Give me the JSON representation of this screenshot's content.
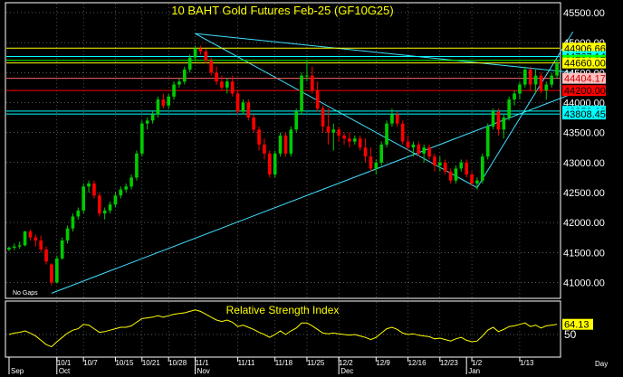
{
  "colors": {
    "background": "#000000",
    "frame": "#ffffff",
    "title": "#ffff00",
    "up_candle": "#00cc00",
    "down_candle": "#ff0000",
    "trendline": "#40e0ff",
    "rsi_line": "#ffff00",
    "grid": "#ffffff"
  },
  "chart_data": [
    {
      "type": "candlestick",
      "title": "10 BAHT Gold Futures Feb-25 (GF10G25)",
      "footnote": "No Gaps",
      "ylim": [
        40750,
        45650
      ],
      "y_ticks": [
        41000,
        41500,
        42000,
        42500,
        43000,
        43500,
        44000,
        44500,
        45000,
        45500
      ],
      "y_tick_labels": [
        "41000.00",
        "41500.00",
        "42000.00",
        "42500.00",
        "43000.00",
        "43500.00",
        "44000.00",
        "44500.00",
        "45000.00",
        "45500.00"
      ],
      "grid": "dotted",
      "bars": 104,
      "candles": [
        [
          0,
          41550,
          41600,
          41520,
          41580
        ],
        [
          1,
          41580,
          41650,
          41540,
          41600
        ],
        [
          2,
          41600,
          41680,
          41560,
          41620
        ],
        [
          3,
          41620,
          41860,
          41600,
          41850
        ],
        [
          4,
          41850,
          41880,
          41700,
          41750
        ],
        [
          5,
          41750,
          41800,
          41600,
          41700
        ],
        [
          6,
          41700,
          41780,
          41500,
          41550
        ],
        [
          7,
          41550,
          41600,
          41300,
          41350
        ],
        [
          8,
          41300,
          41320,
          40950,
          41000
        ],
        [
          9,
          41000,
          41450,
          40980,
          41400
        ],
        [
          10,
          41400,
          41750,
          41380,
          41700
        ],
        [
          11,
          41700,
          41950,
          41650,
          41900
        ],
        [
          12,
          41900,
          42150,
          41850,
          42100
        ],
        [
          13,
          42100,
          42250,
          42050,
          42200
        ],
        [
          14,
          42200,
          42650,
          42150,
          42600
        ],
        [
          15,
          42600,
          42700,
          42500,
          42650
        ],
        [
          16,
          42650,
          42700,
          42400,
          42450
        ],
        [
          17,
          42450,
          42500,
          42100,
          42150
        ],
        [
          18,
          42150,
          42250,
          42050,
          42200
        ],
        [
          19,
          42200,
          42350,
          42150,
          42300
        ],
        [
          20,
          42300,
          42500,
          42250,
          42450
        ],
        [
          21,
          42450,
          42600,
          42400,
          42550
        ],
        [
          22,
          42550,
          42650,
          42500,
          42600
        ],
        [
          23,
          42600,
          42800,
          42550,
          42750
        ],
        [
          24,
          42750,
          43200,
          42700,
          43150
        ],
        [
          25,
          43150,
          43700,
          43100,
          43650
        ],
        [
          26,
          43650,
          43750,
          43550,
          43700
        ],
        [
          27,
          43700,
          43850,
          43650,
          43800
        ],
        [
          28,
          43800,
          44100,
          43750,
          44050
        ],
        [
          29,
          44050,
          44150,
          43900,
          43950
        ],
        [
          30,
          43950,
          44150,
          43900,
          44100
        ],
        [
          31,
          44100,
          44350,
          44050,
          44300
        ],
        [
          32,
          44300,
          44400,
          44250,
          44350
        ],
        [
          33,
          44350,
          44600,
          44300,
          44550
        ],
        [
          34,
          44550,
          44800,
          44500,
          44750
        ],
        [
          35,
          44750,
          44950,
          44700,
          44900
        ],
        [
          36,
          44900,
          44950,
          44800,
          44850
        ],
        [
          37,
          44850,
          44900,
          44650,
          44700
        ],
        [
          38,
          44700,
          44750,
          44450,
          44500
        ],
        [
          39,
          44500,
          44600,
          44300,
          44350
        ],
        [
          40,
          44350,
          44450,
          44200,
          44250
        ],
        [
          41,
          44250,
          44400,
          44150,
          44350
        ],
        [
          42,
          44350,
          44450,
          44100,
          44150
        ],
        [
          43,
          44150,
          44200,
          43800,
          43850
        ],
        [
          44,
          43850,
          44050,
          43800,
          44000
        ],
        [
          45,
          44000,
          44050,
          43700,
          43750
        ],
        [
          46,
          43750,
          43800,
          43500,
          43550
        ],
        [
          47,
          43550,
          43600,
          43200,
          43300
        ],
        [
          48,
          43300,
          43400,
          43050,
          43150
        ],
        [
          49,
          43150,
          43200,
          42750,
          42800
        ],
        [
          50,
          42800,
          43200,
          42750,
          43150
        ],
        [
          51,
          43150,
          43500,
          43100,
          43450
        ],
        [
          52,
          43450,
          43500,
          43100,
          43150
        ],
        [
          53,
          43150,
          43600,
          43100,
          43550
        ],
        [
          54,
          43550,
          43900,
          43500,
          43850
        ],
        [
          55,
          43850,
          44500,
          43800,
          44450
        ],
        [
          56,
          44450,
          44700,
          44350,
          44450
        ],
        [
          57,
          44450,
          44600,
          44150,
          44200
        ],
        [
          58,
          44200,
          44350,
          43850,
          43900
        ],
        [
          59,
          43900,
          43950,
          43500,
          43600
        ],
        [
          60,
          43600,
          43900,
          43300,
          43500
        ],
        [
          61,
          43500,
          43650,
          43200,
          43550
        ],
        [
          62,
          43550,
          43600,
          43350,
          43450
        ],
        [
          63,
          43450,
          43500,
          43300,
          43400
        ],
        [
          64,
          43400,
          43500,
          43250,
          43350
        ],
        [
          65,
          43350,
          43450,
          43300,
          43400
        ],
        [
          66,
          43400,
          43450,
          43200,
          43250
        ],
        [
          67,
          43250,
          43400,
          43000,
          43100
        ],
        [
          68,
          43100,
          43250,
          42850,
          42900
        ],
        [
          69,
          42900,
          43050,
          42800,
          43000
        ],
        [
          70,
          43000,
          43350,
          42950,
          43300
        ],
        [
          71,
          43300,
          43700,
          43250,
          43650
        ],
        [
          72,
          43650,
          43900,
          43600,
          43800
        ],
        [
          73,
          43800,
          43850,
          43600,
          43650
        ],
        [
          74,
          43650,
          43700,
          43300,
          43350
        ],
        [
          75,
          43350,
          43450,
          43200,
          43250
        ],
        [
          76,
          43250,
          43350,
          43100,
          43300
        ],
        [
          77,
          43300,
          43350,
          43100,
          43150
        ],
        [
          78,
          43150,
          43300,
          43000,
          43250
        ],
        [
          79,
          43250,
          43300,
          43050,
          43100
        ],
        [
          80,
          43100,
          43150,
          42850,
          42950
        ],
        [
          81,
          42950,
          43100,
          42850,
          43000
        ],
        [
          82,
          43000,
          43050,
          42800,
          42850
        ],
        [
          83,
          42850,
          42900,
          42650,
          42700
        ],
        [
          84,
          42700,
          42950,
          42650,
          42900
        ],
        [
          85,
          42900,
          43050,
          42850,
          43000
        ],
        [
          86,
          43000,
          43050,
          42750,
          42800
        ],
        [
          87,
          42800,
          42850,
          42600,
          42650
        ],
        [
          88,
          42650,
          42750,
          42550,
          42700
        ],
        [
          89,
          42700,
          43150,
          42650,
          43100
        ],
        [
          90,
          43100,
          43650,
          43050,
          43600
        ],
        [
          91,
          43600,
          43900,
          43550,
          43850
        ],
        [
          92,
          43850,
          43900,
          43450,
          43550
        ],
        [
          93,
          43550,
          43800,
          43400,
          43750
        ],
        [
          94,
          43750,
          44100,
          43700,
          44050
        ],
        [
          95,
          44050,
          44200,
          43950,
          44150
        ],
        [
          96,
          44150,
          44350,
          44050,
          44300
        ],
        [
          97,
          44300,
          44600,
          44250,
          44550
        ],
        [
          98,
          44550,
          44600,
          44200,
          44300
        ],
        [
          99,
          44300,
          44550,
          44150,
          44450
        ],
        [
          100,
          44450,
          44500,
          44150,
          44200
        ],
        [
          101,
          44200,
          44350,
          44050,
          44300
        ],
        [
          102,
          44300,
          44500,
          44250,
          44450
        ],
        [
          103,
          44450,
          44700,
          44400,
          44650
        ]
      ],
      "horizontal_lines": [
        {
          "value": 44906.66,
          "label": "44906.66",
          "color": "#ffff00",
          "label_bg": "#ffff00",
          "label_fg": "#000000"
        },
        {
          "value": 44767.14,
          "label": "44767.14",
          "color": "#00ffff",
          "label_bg": "#00ffff",
          "label_fg": "#000000"
        },
        {
          "value": 44704.17,
          "label": "44704.17",
          "color": "#00ff00",
          "label_bg": "#00ff00",
          "label_fg": "#000000"
        },
        {
          "value": 44660.0,
          "label": "44660.00",
          "color": "#ffff00",
          "label_bg": "#ffff00",
          "label_fg": "#000000"
        },
        {
          "value": 44404.17,
          "label": "44404.17",
          "color": "#ff6060",
          "label_bg": "#ffc0c0",
          "label_fg": "#cc0000"
        },
        {
          "value": 44200.0,
          "label": "44200.00",
          "color": "#ff0000",
          "label_bg": "#ff0000",
          "label_fg": "#000000"
        },
        {
          "value": 43858.63,
          "label": "43858.63",
          "color": "#00ffff",
          "label_bg": "#00ffff",
          "label_fg": "#000000"
        },
        {
          "value": 43808.45,
          "label": "43808.45",
          "color": "#00ffff",
          "label_bg": "#00ffff",
          "label_fg": "#000000"
        }
      ],
      "trendlines": [
        {
          "from": [
            8,
            40820
          ],
          "to": [
            106,
            44150
          ]
        },
        {
          "from": [
            35,
            45150
          ],
          "to": [
            106,
            44500
          ]
        },
        {
          "from": [
            35,
            45150
          ],
          "to": [
            88,
            42580
          ]
        },
        {
          "from": [
            88,
            42580
          ],
          "to": [
            106,
            45180
          ]
        }
      ],
      "x_ticks": [
        {
          "bar": 9,
          "label": "10/1"
        },
        {
          "bar": 14,
          "label": "10/7"
        },
        {
          "bar": 20,
          "label": "10/15"
        },
        {
          "bar": 25,
          "label": "10/21"
        },
        {
          "bar": 30,
          "label": "10/28"
        },
        {
          "bar": 35,
          "label": "11/1"
        },
        {
          "bar": 43,
          "label": "11/11"
        },
        {
          "bar": 50,
          "label": "11/18"
        },
        {
          "bar": 56,
          "label": "11/25"
        },
        {
          "bar": 62,
          "label": "12/2"
        },
        {
          "bar": 69,
          "label": "12/9"
        },
        {
          "bar": 75,
          "label": "12/16"
        },
        {
          "bar": 81,
          "label": "12/23"
        },
        {
          "bar": 87,
          "label": "1/2"
        },
        {
          "bar": 96,
          "label": "1/13"
        }
      ],
      "month_labels": [
        {
          "bar": 0,
          "label": "Sep"
        },
        {
          "bar": 9,
          "label": "Oct"
        },
        {
          "bar": 35,
          "label": "Nov"
        },
        {
          "bar": 62,
          "label": "Dec"
        },
        {
          "bar": 86,
          "label": "Jan"
        }
      ],
      "x_axis_unit": "Day"
    },
    {
      "type": "line",
      "title": "Relative Strength Index",
      "ylim": [
        20,
        95
      ],
      "y_ticks": [
        50
      ],
      "y_tick_labels": [
        "50"
      ],
      "last_value": 64.13,
      "last_value_label": "64.13",
      "values": [
        50,
        52,
        53,
        55,
        52,
        48,
        42,
        36,
        33,
        40,
        46,
        52,
        56,
        58,
        64,
        63,
        58,
        53,
        54,
        56,
        58,
        60,
        60,
        62,
        67,
        72,
        73,
        74,
        76,
        74,
        76,
        78,
        79,
        80,
        82,
        84,
        82,
        78,
        74,
        70,
        68,
        70,
        67,
        61,
        63,
        60,
        57,
        53,
        50,
        46,
        50,
        55,
        50,
        55,
        59,
        66,
        66,
        62,
        57,
        52,
        51,
        52,
        51,
        50,
        49,
        50,
        48,
        46,
        43,
        46,
        52,
        58,
        60,
        57,
        52,
        50,
        51,
        49,
        48,
        47,
        44,
        45,
        43,
        41,
        44,
        46,
        42,
        40,
        41,
        48,
        56,
        60,
        54,
        57,
        61,
        62,
        64,
        66,
        61,
        63,
        59,
        62,
        63,
        64
      ]
    }
  ]
}
